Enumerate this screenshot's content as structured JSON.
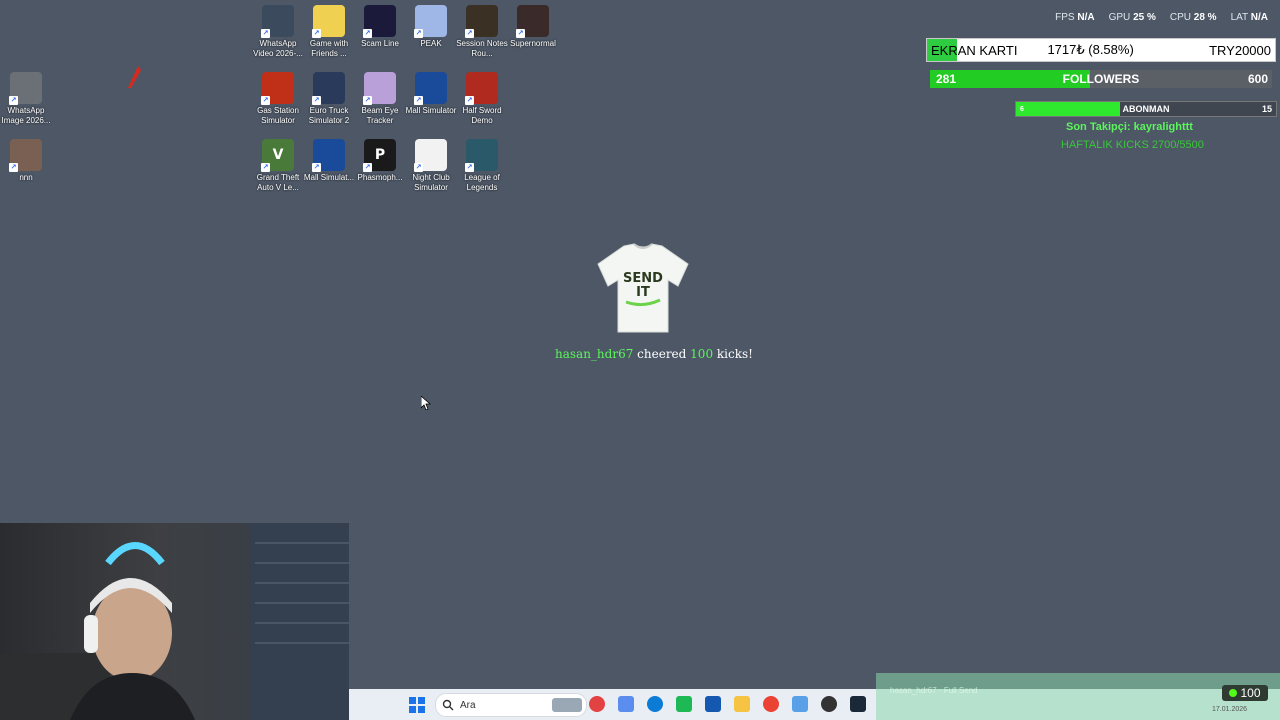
{
  "desktop": {
    "icons": [
      {
        "label": "WhatsApp Image 2026...",
        "color": "#6b6f76",
        "glyph": ""
      },
      {
        "label": "nnn",
        "color": "#7a6052",
        "glyph": ""
      },
      {
        "label": "WhatsApp Video 2026-...",
        "color": "#3b4a5c",
        "glyph": ""
      },
      {
        "label": "Game with Friends ...",
        "color": "#f0d050",
        "glyph": ""
      },
      {
        "label": "Scam Line",
        "color": "#1c1a3a",
        "glyph": ""
      },
      {
        "label": "PEAK",
        "color": "#9fb7e6",
        "glyph": ""
      },
      {
        "label": "Session Notes Rou...",
        "color": "#3a3024",
        "glyph": ""
      },
      {
        "label": "Supernormal",
        "color": "#3a2a2a",
        "glyph": ""
      },
      {
        "label": "Gas Station Simulator",
        "color": "#c03018",
        "glyph": ""
      },
      {
        "label": "Euro Truck Simulator 2",
        "color": "#2a3a5a",
        "glyph": ""
      },
      {
        "label": "Beam Eye Tracker",
        "color": "#b9a0d8",
        "glyph": ""
      },
      {
        "label": "Mall Simulator",
        "color": "#1a4a9a",
        "glyph": ""
      },
      {
        "label": "Half Sword Demo",
        "color": "#b02a20",
        "glyph": ""
      },
      {
        "label": "Grand Theft Auto V Le...",
        "color": "#4a7a3a",
        "glyph": "V"
      },
      {
        "label": "Mall Simulat...",
        "color": "#1a4a9a",
        "glyph": ""
      },
      {
        "label": "Phasmoph...",
        "color": "#1a1a1a",
        "glyph": "P"
      },
      {
        "label": "Night Club Simulator",
        "color": "#f2f2f2",
        "glyph": ""
      },
      {
        "label": "League of Legends",
        "color": "#2a5a6a",
        "glyph": ""
      }
    ]
  },
  "stats": {
    "fps_label": "FPS",
    "fps_value": "N/A",
    "gpu_label": "GPU",
    "gpu_value": "25 %",
    "cpu_label": "CPU",
    "cpu_value": "28 %",
    "lat_label": "LAT",
    "lat_value": "N/A"
  },
  "ekran": {
    "title": "EKRAN KARTI",
    "amount": "1717₺ (8.58%)",
    "goal": "TRY20000",
    "progress": 0.0858
  },
  "followers": {
    "current": "281",
    "label": "FOLLOWERS",
    "goal": "600",
    "progress": 0.468
  },
  "abonman": {
    "current": "6",
    "label": "ABONMAN",
    "goal": "15",
    "progress": 0.4
  },
  "last_follower": "Son Takipçi: kayralighttt",
  "weekly_kicks": "HAFTALIK KICKS 2700/5500",
  "alert": {
    "username": "hasan_hdr67",
    "verb": "cheered",
    "amount": "100",
    "suffix": "kicks!",
    "shirt_line1": "SEND",
    "shirt_line2": "IT"
  },
  "taskbar": {
    "search_placeholder": "Ara",
    "apps": [
      "#e34242",
      "#5b8def",
      "#0b7bd6",
      "#1db954",
      "#1558b0",
      "#f6c343",
      "#ea4335",
      "#5aa0e8",
      "#333333",
      "#1b2838"
    ]
  },
  "tray": {
    "overlay_text": "hasan_hdr67 · Full Send",
    "kick_count": "100",
    "date": "17.01.2026"
  }
}
